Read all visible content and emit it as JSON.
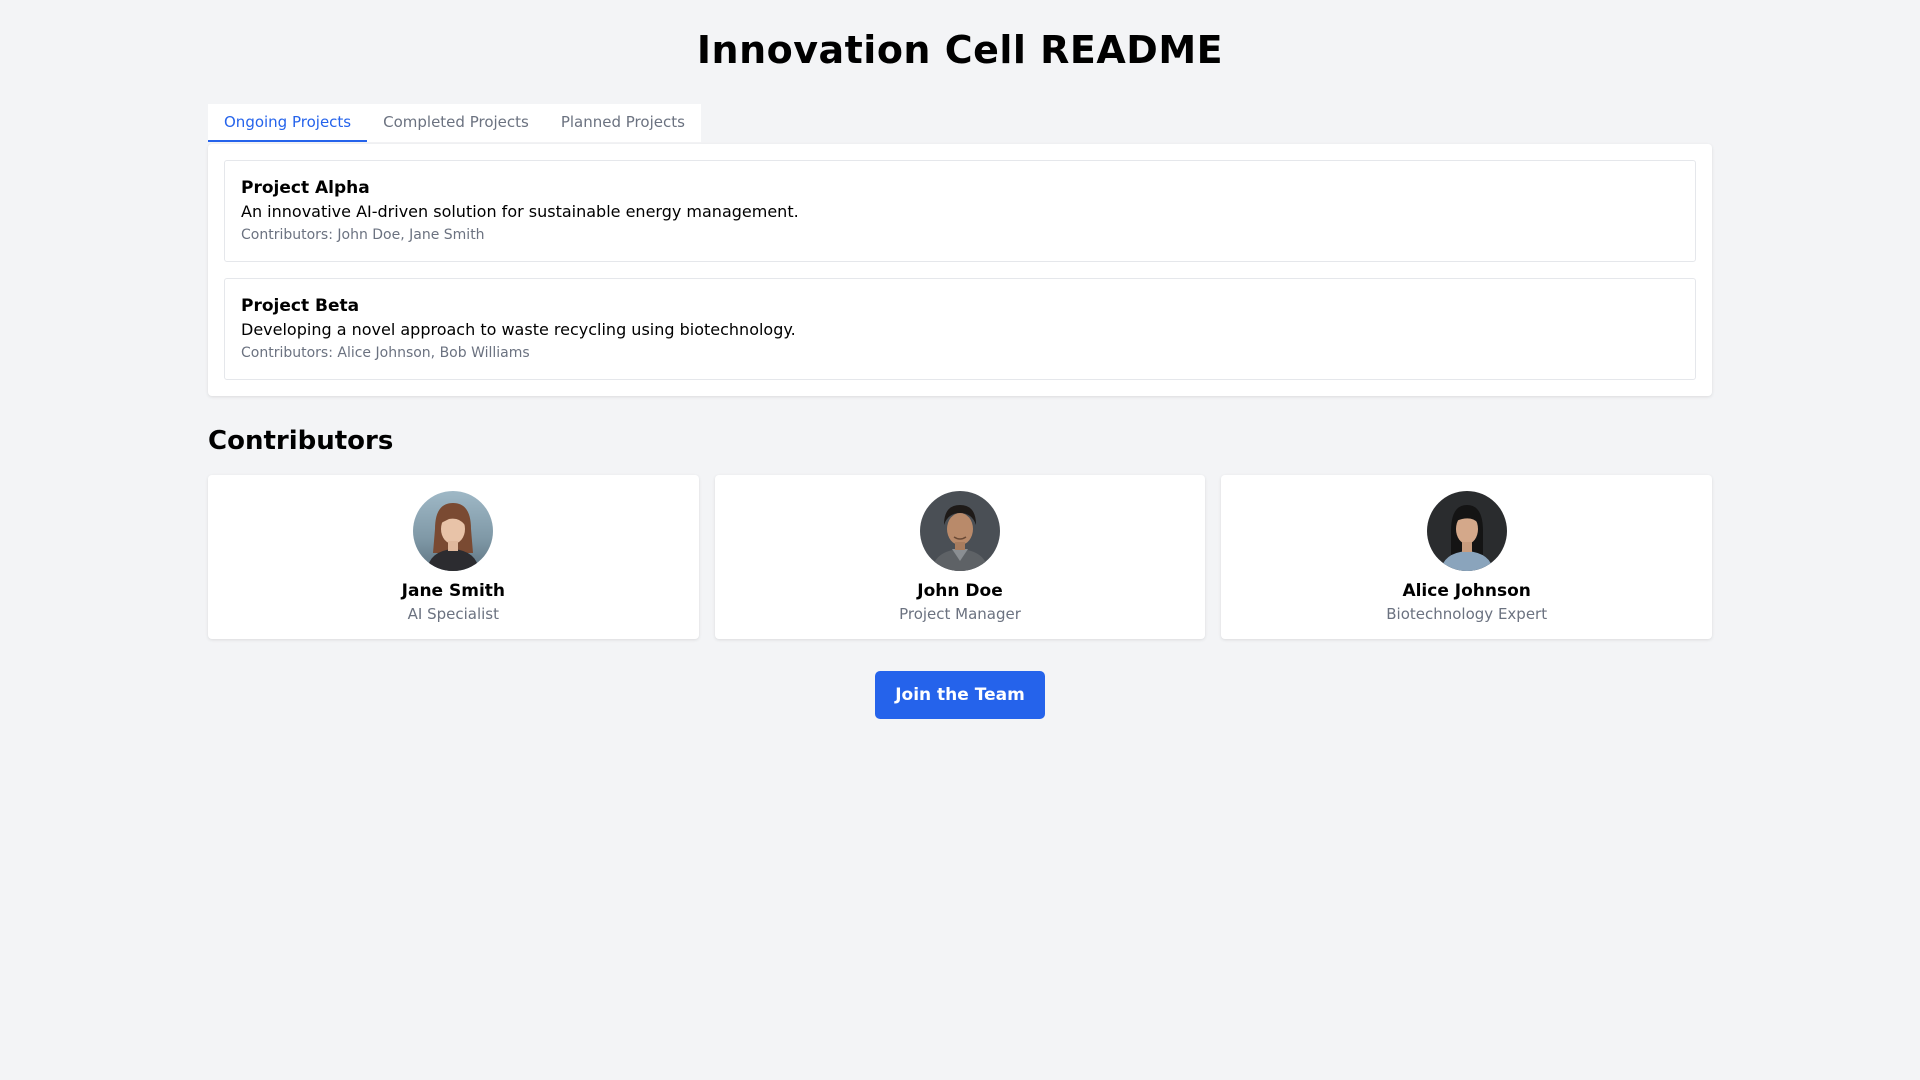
{
  "page": {
    "title": "Innovation Cell README"
  },
  "tabs": [
    {
      "label": "Ongoing Projects",
      "active": true
    },
    {
      "label": "Completed Projects",
      "active": false
    },
    {
      "label": "Planned Projects",
      "active": false
    }
  ],
  "projects": [
    {
      "name": "Project Alpha",
      "description": "An innovative AI-driven solution for sustainable energy management.",
      "contributors": "Contributors: John Doe, Jane Smith"
    },
    {
      "name": "Project Beta",
      "description": "Developing a novel approach to waste recycling using biotechnology.",
      "contributors": "Contributors: Alice Johnson, Bob Williams"
    }
  ],
  "contributors_section": {
    "title": "Contributors",
    "people": [
      {
        "name": "Jane Smith",
        "role": "AI Specialist"
      },
      {
        "name": "John Doe",
        "role": "Project Manager"
      },
      {
        "name": "Alice Johnson",
        "role": "Biotechnology Expert"
      }
    ]
  },
  "cta": {
    "label": "Join the Team"
  },
  "colors": {
    "accent": "#2563eb",
    "muted": "#6b7280",
    "background": "#f3f4f6"
  }
}
